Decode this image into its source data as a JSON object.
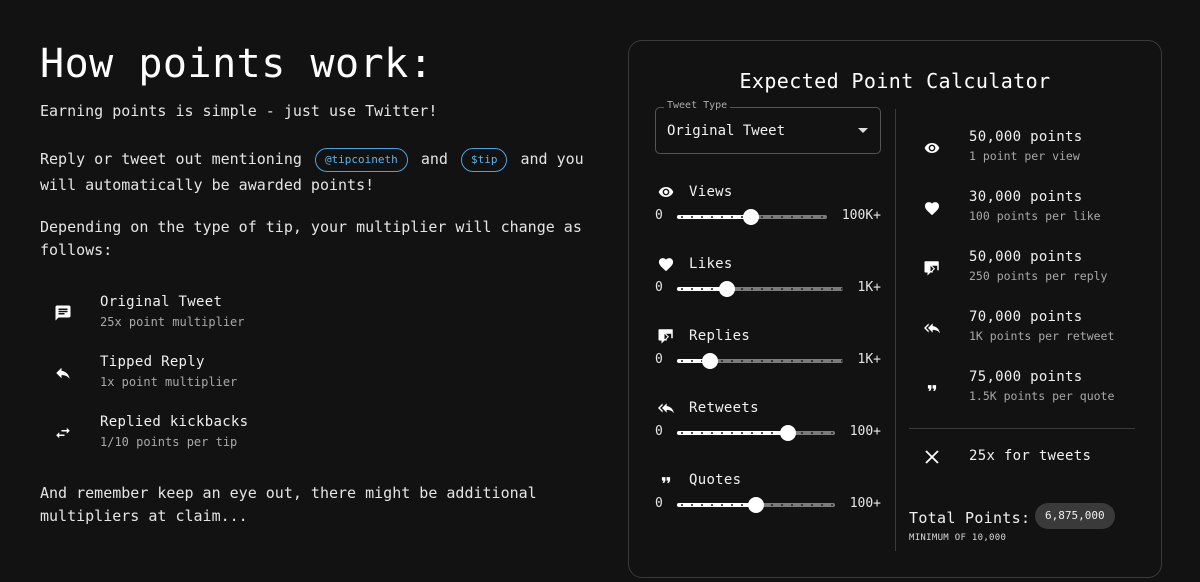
{
  "left": {
    "title": "How points work:",
    "intro": "Earning points is simple - just use Twitter!",
    "mention_before": "Reply or tweet out mentioning",
    "chip_handle": "@tipcoineth",
    "mention_and": "and",
    "chip_ticker": "$tip",
    "mention_after": "and you will automatically be awarded points!",
    "depending": "Depending on the type of tip, your multiplier will change as follows:",
    "types": [
      {
        "icon": "comment-icon",
        "title": "Original Tweet",
        "desc": "25x point multiplier"
      },
      {
        "icon": "reply-icon",
        "title": "Tipped Reply",
        "desc": "1x point multiplier"
      },
      {
        "icon": "swap-icon",
        "title": "Replied kickbacks",
        "desc": "1/10 points per tip"
      }
    ],
    "footer": "And remember keep an eye out, there might be additional multipliers at claim..."
  },
  "calculator": {
    "title": "Expected Point Calculator",
    "select": {
      "label": "Tweet Type",
      "value": "Original Tweet"
    },
    "sliders": [
      {
        "icon": "eye-icon",
        "label": "Views",
        "min": "0",
        "max": "100K+",
        "fraction": 0.49
      },
      {
        "icon": "heart-icon",
        "label": "Likes",
        "min": "0",
        "max": "1K+",
        "fraction": 0.3
      },
      {
        "icon": "reply-bubble-icon",
        "label": "Replies",
        "min": "0",
        "max": "1K+",
        "fraction": 0.2
      },
      {
        "icon": "reply-all-icon",
        "label": "Retweets",
        "min": "0",
        "max": "100+",
        "fraction": 0.7
      },
      {
        "icon": "quote-icon",
        "label": "Quotes",
        "min": "0",
        "max": "100+",
        "fraction": 0.5
      }
    ],
    "results": [
      {
        "icon": "eye-icon",
        "points": "50,000 points",
        "rate": "1 point per view"
      },
      {
        "icon": "heart-icon",
        "points": "30,000 points",
        "rate": "100 points per like"
      },
      {
        "icon": "reply-bubble-icon",
        "points": "50,000 points",
        "rate": "250 points per reply"
      },
      {
        "icon": "reply-all-icon",
        "points": "70,000 points",
        "rate": "1K points per retweet"
      },
      {
        "icon": "quote-icon",
        "points": "75,000 points",
        "rate": "1.5K points per quote"
      }
    ],
    "multiplier": {
      "icon": "close-icon",
      "text": "25x for tweets"
    },
    "total_label": "Total Points:",
    "total_value": "6,875,000",
    "minimum": "MINIMUM OF 10,000"
  }
}
